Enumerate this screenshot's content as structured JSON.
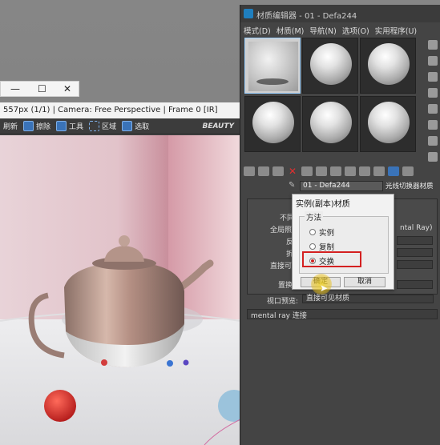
{
  "mini_window": {
    "minimize": "—",
    "maximize": "☐",
    "close": "✕"
  },
  "frame_window": {
    "title": "557px (1/1) | Camera: Free Perspective | Frame 0 [IR]",
    "toolbar": {
      "refresh": "刷新",
      "erase": "擦除",
      "tools": "工具",
      "region": "区域",
      "select": "选取",
      "mode": "BEAUTY"
    }
  },
  "material_editor": {
    "title": "材质编辑器 - 01 - Defa244",
    "menu": [
      "模式(D)",
      "材质(M)",
      "导航(N)",
      "选项(O)",
      "实用程序(U)"
    ],
    "material_name": "01 - Defa244",
    "material_type": "光线切换器材质",
    "param_labels": {
      "p1": "不同",
      "p2": "全局照",
      "p3": "反",
      "p4": "折",
      "p5": "直接可",
      "p6": "置换",
      "viewport_label": "视口预览:",
      "viewport_value": "直接可见材质",
      "extra": "ntal Ray)"
    },
    "mental_ray_label": "mental ray 连接"
  },
  "dialog": {
    "title": "实例(副本)材质",
    "group_label": "方法",
    "options": [
      {
        "label": "实例",
        "selected": false
      },
      {
        "label": "复制",
        "selected": false
      },
      {
        "label": "交换",
        "selected": true
      }
    ],
    "ok": "确定",
    "cancel": "取消"
  },
  "colors": {
    "accent_red": "#d42020",
    "highlight_blue": "#3a73b8"
  }
}
